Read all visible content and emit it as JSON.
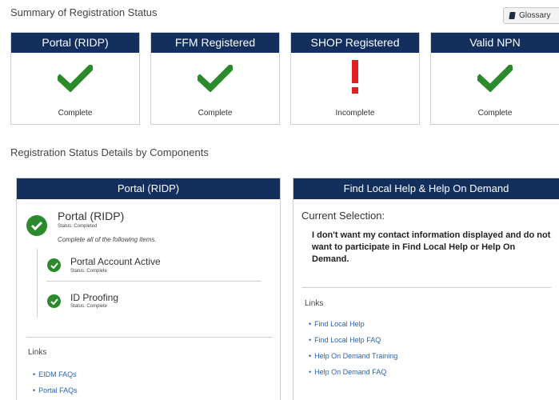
{
  "header": {
    "title": "Summary of Registration Status",
    "glossary_label": "Glossary"
  },
  "summary_cards": [
    {
      "title": "Portal (RIDP)",
      "status": "Complete",
      "icon": "check-icon"
    },
    {
      "title": "FFM Registered",
      "status": "Complete",
      "icon": "check-icon"
    },
    {
      "title": "SHOP Registered",
      "status": "Incomplete",
      "icon": "exclamation-icon"
    },
    {
      "title": "Valid NPN",
      "status": "Complete",
      "icon": "check-icon"
    }
  ],
  "details": {
    "section_title": "Registration Status Details by Components",
    "portal_panel": {
      "header": "Portal (RIDP)",
      "component_title": "Portal (RIDP)",
      "component_status": "Status: Completed",
      "instruction": "Complete all of the following items.",
      "subitems": [
        {
          "title": "Portal Account Active",
          "status": "Status: Complete"
        },
        {
          "title": "ID Proofing",
          "status": "Status: Complete"
        }
      ],
      "links_label": "Links",
      "links": [
        "EIDM FAQs",
        "Portal FAQs"
      ]
    },
    "help_panel": {
      "header": "Find Local Help & Help On Demand",
      "current_selection_label": "Current Selection:",
      "selection_text": "I don't want my contact information displayed and do not want to participate in Find Local Help or Help On Demand.",
      "links_label": "Links",
      "links": [
        "Find Local Help",
        "Find Local Help FAQ",
        "Help On Demand Training",
        "Help On Demand FAQ"
      ]
    }
  },
  "colors": {
    "header_navy": "#122f5e",
    "success_green": "#2b8a2b",
    "error_red": "#e02020",
    "link_blue": "#2a63b2"
  }
}
